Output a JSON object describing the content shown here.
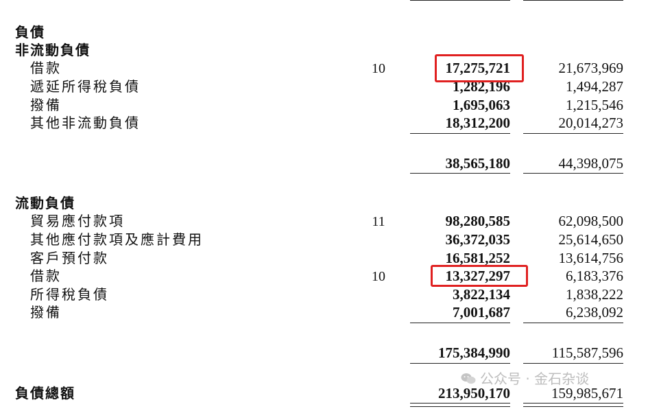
{
  "liabilities": {
    "heading": "負債",
    "non_current": {
      "heading": "非流動負債",
      "rows": [
        {
          "label": "借款",
          "note": "10",
          "current": "17,275,721",
          "prior": "21,673,969"
        },
        {
          "label": "遞延所得稅負債",
          "note": "",
          "current": "1,282,196",
          "prior": "1,494,287"
        },
        {
          "label": "撥備",
          "note": "",
          "current": "1,695,063",
          "prior": "1,215,546"
        },
        {
          "label": "其他非流動負債",
          "note": "",
          "current": "18,312,200",
          "prior": "20,014,273"
        }
      ],
      "subtotal": {
        "current": "38,565,180",
        "prior": "44,398,075"
      }
    },
    "current": {
      "heading": "流動負債",
      "rows": [
        {
          "label": "貿易應付款項",
          "note": "11",
          "current": "98,280,585",
          "prior": "62,098,500"
        },
        {
          "label": "其他應付款項及應計費用",
          "note": "",
          "current": "36,372,035",
          "prior": "25,614,650"
        },
        {
          "label": "客戶預付款",
          "note": "",
          "current": "16,581,252",
          "prior": "13,614,756"
        },
        {
          "label": "借款",
          "note": "10",
          "current": "13,327,297",
          "prior": "6,183,376"
        },
        {
          "label": "所得稅負債",
          "note": "",
          "current": "3,822,134",
          "prior": "1,838,222"
        },
        {
          "label": "撥備",
          "note": "",
          "current": "7,001,687",
          "prior": "6,238,092"
        }
      ],
      "subtotal": {
        "current": "175,384,990",
        "prior": "115,587,596"
      }
    },
    "total": {
      "label": "負債總額",
      "current": "213,950,170",
      "prior": "159,985,671"
    }
  },
  "watermark": {
    "text": "公众号 · 金石杂谈",
    "icon": "wechat-icon"
  },
  "highlight_color": "#e02020"
}
